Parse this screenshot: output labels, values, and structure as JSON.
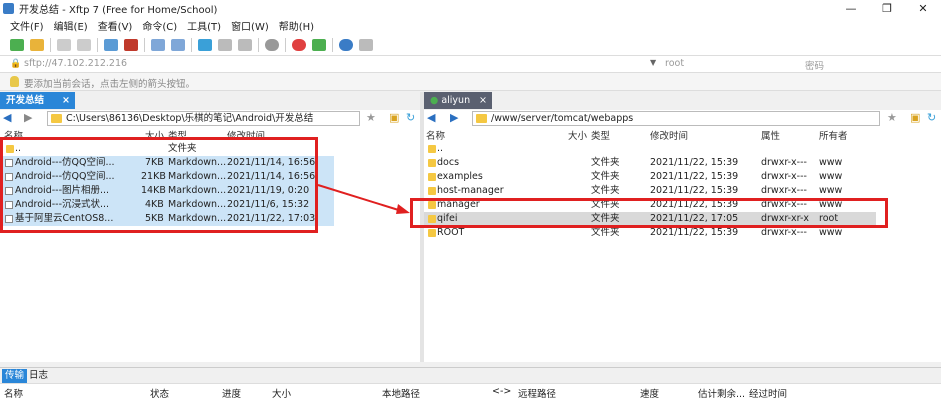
{
  "window": {
    "title": "开发总结 - Xftp 7 (Free for Home/School)",
    "min": "—",
    "max": "❐",
    "close": "✕"
  },
  "menu": [
    "文件(F)",
    "编辑(E)",
    "查看(V)",
    "命令(C)",
    "工具(T)",
    "窗口(W)",
    "帮助(H)"
  ],
  "address": {
    "url": "sftp://47.102.212.216",
    "user_placeholder": "root",
    "password_placeholder": "密码"
  },
  "hint": "要添加当前会话，点击左侧的箭头按钮。",
  "left": {
    "tab": "开发总结",
    "path": "C:\\Users\\86136\\Desktop\\乐棋的笔记\\Android\\开发总结",
    "columns": [
      "名称",
      "大小",
      "类型",
      "修改时间"
    ],
    "rows": [
      {
        "name": "..",
        "size": "",
        "type": "文件夹",
        "mtime": ""
      },
      {
        "name": "Android---仿QQ空间...",
        "size": "7KB",
        "type": "Markdown...",
        "mtime": "2021/11/14, 16:56"
      },
      {
        "name": "Android---仿QQ空间...",
        "size": "21KB",
        "type": "Markdown...",
        "mtime": "2021/11/14, 16:56"
      },
      {
        "name": "Android---图片相册...",
        "size": "14KB",
        "type": "Markdown...",
        "mtime": "2021/11/19, 0:20"
      },
      {
        "name": "Android---沉浸式状...",
        "size": "4KB",
        "type": "Markdown...",
        "mtime": "2021/11/6, 15:32"
      },
      {
        "name": "基于阿里云CentOS8...",
        "size": "5KB",
        "type": "Markdown...",
        "mtime": "2021/11/22, 17:03"
      }
    ]
  },
  "right": {
    "tab": "aliyun",
    "path": "/www/server/tomcat/webapps",
    "columns": [
      "名称",
      "大小",
      "类型",
      "修改时间",
      "属性",
      "所有者"
    ],
    "rows": [
      {
        "name": "..",
        "size": "",
        "type": "",
        "mtime": "",
        "attr": "",
        "owner": ""
      },
      {
        "name": "docs",
        "size": "",
        "type": "文件夹",
        "mtime": "2021/11/22, 15:39",
        "attr": "drwxr-x---",
        "owner": "www"
      },
      {
        "name": "examples",
        "size": "",
        "type": "文件夹",
        "mtime": "2021/11/22, 15:39",
        "attr": "drwxr-x---",
        "owner": "www"
      },
      {
        "name": "host-manager",
        "size": "",
        "type": "文件夹",
        "mtime": "2021/11/22, 15:39",
        "attr": "drwxr-x---",
        "owner": "www"
      },
      {
        "name": "manager",
        "size": "",
        "type": "文件夹",
        "mtime": "2021/11/22, 15:39",
        "attr": "drwxr-x---",
        "owner": "www"
      },
      {
        "name": "qifei",
        "size": "",
        "type": "文件夹",
        "mtime": "2021/11/22, 17:05",
        "attr": "drwxr-xr-x",
        "owner": "root"
      },
      {
        "name": "ROOT",
        "size": "",
        "type": "文件夹",
        "mtime": "2021/11/22, 15:39",
        "attr": "drwxr-x---",
        "owner": "www"
      }
    ]
  },
  "bottom": {
    "tabs": [
      "传输",
      "日志"
    ],
    "columns": [
      "名称",
      "状态",
      "进度",
      "大小",
      "本地路径",
      "<->",
      "远程路径",
      "速度",
      "估计剩余...",
      "经过时间"
    ]
  },
  "colors": {
    "accent": "#2a86d8",
    "highlight": "#e02020",
    "selection": "#cce4f7"
  }
}
